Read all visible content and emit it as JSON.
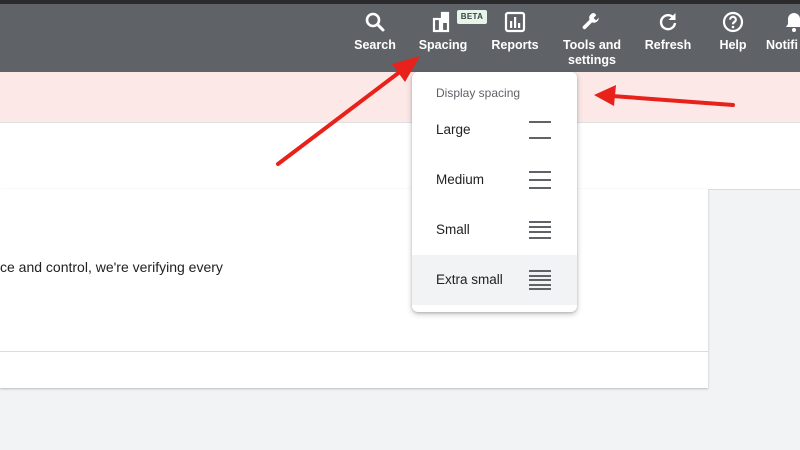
{
  "toolbar": {
    "items": [
      {
        "label": "Search",
        "icon": "search-icon"
      },
      {
        "label": "Spacing",
        "icon": "spacing-icon"
      },
      {
        "label": "Reports",
        "icon": "reports-icon"
      },
      {
        "label": "Tools and",
        "label2": "settings",
        "icon": "wrench-icon"
      },
      {
        "label": "Refresh",
        "icon": "refresh-icon"
      },
      {
        "label": "Help",
        "icon": "help-icon"
      },
      {
        "label": "Notifi",
        "icon": "bell-icon"
      }
    ],
    "beta_badge": "BETA"
  },
  "card": {
    "text": "ce and control, we're verifying every"
  },
  "spacing_menu": {
    "title": "Display spacing",
    "items": [
      {
        "label": "Large",
        "icon": "spacing-large-icon",
        "lines": 2,
        "selected": false
      },
      {
        "label": "Medium",
        "icon": "spacing-medium-icon",
        "lines": 3,
        "selected": false
      },
      {
        "label": "Small",
        "icon": "spacing-small-icon",
        "lines": 4,
        "selected": false
      },
      {
        "label": "Extra small",
        "icon": "spacing-extra-small-icon",
        "lines": 5,
        "selected": true
      }
    ]
  },
  "colors": {
    "topbar": "#5f6368",
    "alert_band": "#fce8e6",
    "arrow": "#e8211a",
    "beta_badge": "#e6f4ea"
  }
}
